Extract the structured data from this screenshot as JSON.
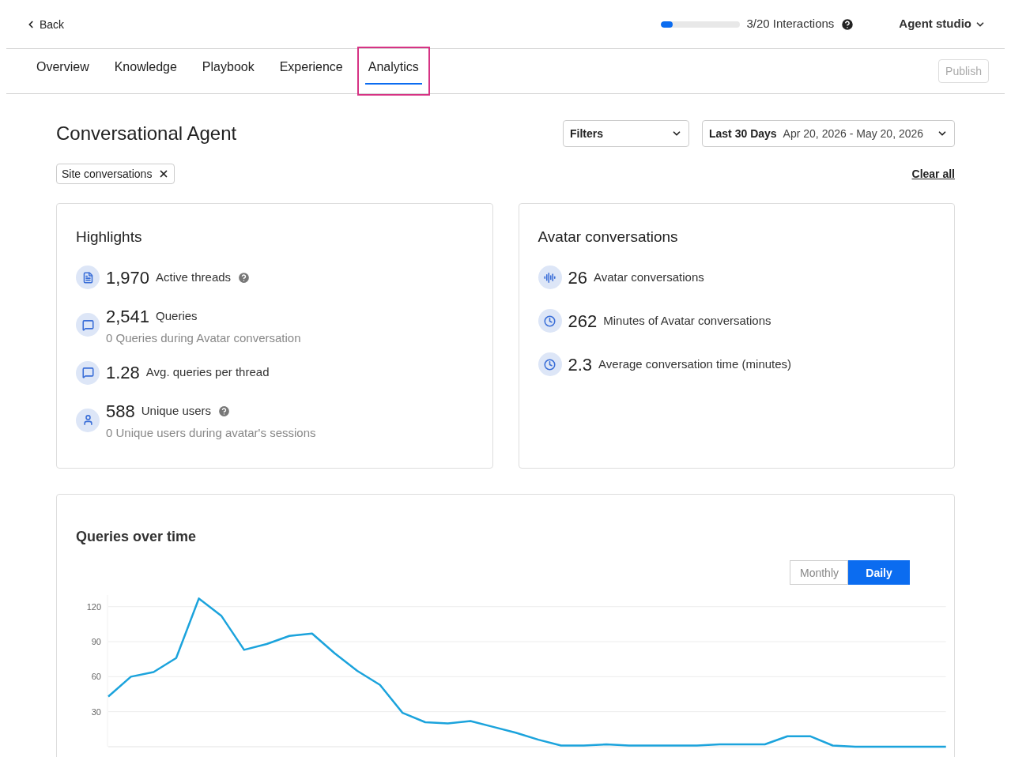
{
  "header": {
    "back": "Back",
    "interactions": {
      "label": "3/20 Interactions",
      "level": 0.15
    },
    "workspace": "Agent studio"
  },
  "tabs": [
    {
      "label": "Overview",
      "selected": false
    },
    {
      "label": "Knowledge",
      "selected": false
    },
    {
      "label": "Playbook",
      "selected": false
    },
    {
      "label": "Experience",
      "selected": false
    },
    {
      "label": "Analytics",
      "selected": true
    }
  ],
  "publish": {
    "label": "Publish",
    "disabled": true
  },
  "page_title": "Conversational Agent",
  "filters": {
    "label": "Filters"
  },
  "date_range": {
    "label": "Last 30 Days",
    "value": "Apr 20, 2026 - May 20, 2026"
  },
  "chips": [
    {
      "label": "Site conversations"
    }
  ],
  "clear_all": "Clear all",
  "highlights": {
    "title": "Highlights",
    "items": [
      {
        "kind": "thread",
        "value": "1,970",
        "label": "Active threads",
        "help": true
      },
      {
        "kind": "query",
        "value": "2,541",
        "label": "Queries",
        "help": false,
        "sub": "0 Queries during Avatar conversation"
      },
      {
        "kind": "query",
        "value": "1.28",
        "label": "Avg. queries per thread",
        "help": false
      },
      {
        "kind": "user",
        "value": "588",
        "label": "Unique users",
        "help": true,
        "sub": "0 Unique users during avatar's sessions"
      }
    ]
  },
  "avatar": {
    "title": "Avatar conversations",
    "items": [
      {
        "kind": "wave",
        "value": "26",
        "label": "Avatar conversations"
      },
      {
        "kind": "clock",
        "value": "262",
        "label": "Minutes of Avatar conversations"
      },
      {
        "kind": "clock",
        "value": "2.3",
        "label": "Average conversation time (minutes)"
      }
    ]
  },
  "queries_chart": {
    "title": "Queries over time",
    "toggle": [
      {
        "label": "Monthly",
        "selected": false
      },
      {
        "label": "Daily",
        "selected": true
      }
    ],
    "chart_data": {
      "type": "line",
      "yticks": [
        30,
        60,
        90,
        120
      ],
      "ylim": [
        0,
        130
      ],
      "grid": true,
      "series": [
        {
          "color": "#1ba3dc",
          "values": [
            43,
            60,
            64,
            76,
            127,
            112,
            83,
            88,
            95,
            97,
            80,
            65,
            53,
            29,
            21,
            20,
            22,
            17,
            12,
            6,
            1,
            1,
            2,
            1,
            1,
            1,
            1,
            2,
            2,
            2,
            9,
            9,
            1,
            0,
            0,
            0,
            0,
            0
          ]
        }
      ]
    }
  }
}
